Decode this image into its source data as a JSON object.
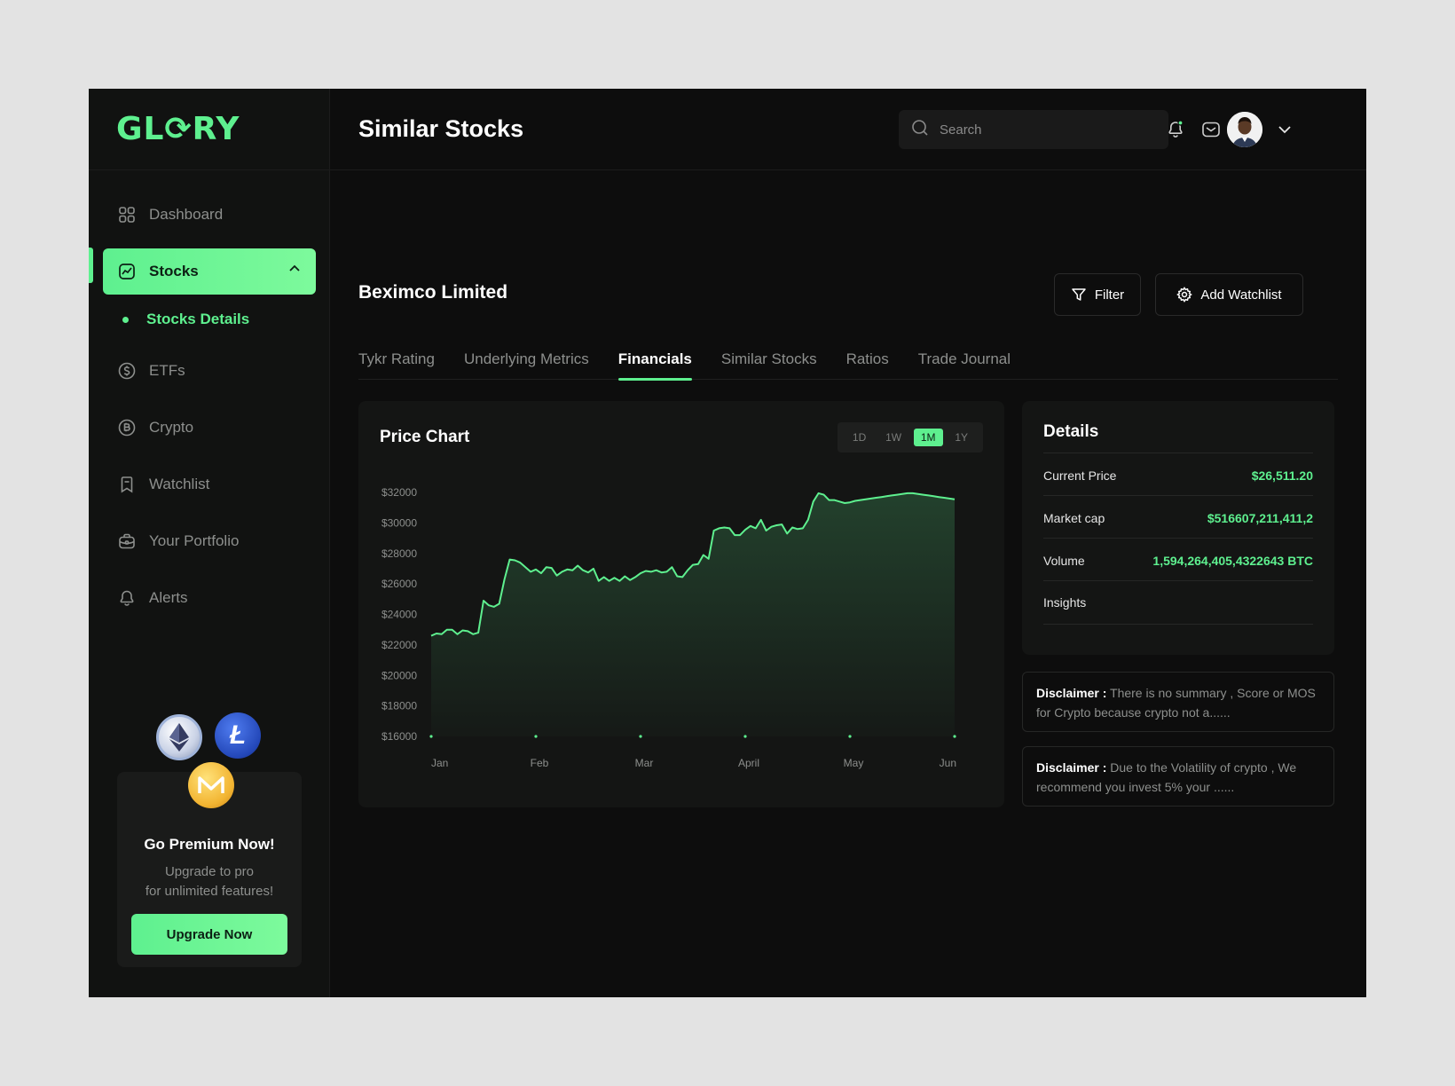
{
  "app": {
    "logo": "GL⟳RY"
  },
  "sidebar": {
    "items": [
      {
        "label": "Dashboard",
        "icon": "dashboard-icon"
      },
      {
        "label": "Stocks",
        "icon": "stocks-icon",
        "active": true
      },
      {
        "label": "Stocks Details",
        "icon": "dot-icon",
        "sub": true
      },
      {
        "label": "ETFs",
        "icon": "dollar-coin-icon"
      },
      {
        "label": "Crypto",
        "icon": "bitcoin-icon"
      },
      {
        "label": "Watchlist",
        "icon": "bookmark-icon"
      },
      {
        "label": "Your Portfolio",
        "icon": "briefcase-icon"
      },
      {
        "label": "Alerts",
        "icon": "bell-icon"
      }
    ],
    "premium": {
      "title": "Go Premium Now!",
      "line1": "Upgrade to pro",
      "line2": "for unlimited features!",
      "button": "Upgrade Now"
    }
  },
  "header": {
    "title": "Similar Stocks",
    "search_placeholder": "Search"
  },
  "main": {
    "company": "Beximco Limited",
    "filter_label": "Filter",
    "watchlist_label": "Add Watchlist",
    "tabs": [
      "Tykr Rating",
      "Underlying Metrics",
      "Financials",
      "Similar Stocks",
      "Ratios",
      "Trade Journal"
    ],
    "active_tab": "Financials"
  },
  "chart_card": {
    "title": "Price Chart",
    "ranges": [
      "1D",
      "1W",
      "1M",
      "1Y"
    ],
    "active_range": "1M"
  },
  "chart_data": {
    "type": "area",
    "title": "Price Chart",
    "xlabel": "",
    "ylabel": "",
    "x_tick_labels": [
      "Jan",
      "Feb",
      "Mar",
      "April",
      "May",
      "Jun"
    ],
    "y_tick_labels": [
      "$32000",
      "$30000",
      "$28000",
      "$26000",
      "$24000",
      "$22000",
      "$20000",
      "$18000",
      "$16000"
    ],
    "ylim": [
      16000,
      32000
    ],
    "xlim": [
      0,
      5
    ],
    "color": "#5ef08f",
    "grid": false,
    "series": [
      {
        "x": [
          0,
          0.05,
          0.1,
          0.15,
          0.2,
          0.25,
          0.3,
          0.35,
          0.4,
          0.45,
          0.5,
          0.55,
          0.6,
          0.65,
          0.7,
          0.75,
          0.8,
          0.85,
          0.9,
          0.95,
          1.0,
          1.05,
          1.1,
          1.15,
          1.2,
          1.25,
          1.3,
          1.35,
          1.4,
          1.45,
          1.5,
          1.55,
          1.6,
          1.65,
          1.7,
          1.75,
          1.8,
          1.85,
          1.9,
          1.95,
          2.0,
          2.05,
          2.1,
          2.15,
          2.2,
          2.25,
          2.3,
          2.35,
          2.4,
          2.45,
          2.5,
          2.55,
          2.6,
          2.65,
          2.7,
          2.75,
          2.8,
          2.85,
          2.9,
          2.95,
          3.0,
          3.05,
          3.1,
          3.15,
          3.2,
          3.25,
          3.3,
          3.35,
          3.4,
          3.45,
          3.5,
          3.55,
          3.6,
          3.65,
          3.7,
          3.75,
          3.8,
          3.85,
          3.9,
          3.95,
          4.0,
          4.05,
          4.1,
          4.15,
          4.2,
          4.25,
          4.3,
          4.35,
          4.4,
          4.45,
          4.5,
          4.55,
          4.6,
          4.65,
          4.7,
          4.75,
          4.8,
          4.85,
          4.9,
          4.95,
          5.0
        ],
        "y": [
          22600,
          22750,
          22700,
          23000,
          23000,
          22700,
          22950,
          22900,
          22700,
          22800,
          24900,
          24600,
          24500,
          24700,
          26300,
          27600,
          27550,
          27400,
          27100,
          26800,
          26950,
          26700,
          27100,
          27050,
          26550,
          26800,
          26950,
          26900,
          27200,
          26900,
          26750,
          27000,
          26200,
          26450,
          26200,
          26400,
          26200,
          26500,
          26250,
          26450,
          26700,
          26850,
          26800,
          26900,
          26750,
          26800,
          27100,
          26500,
          26450,
          26900,
          27250,
          27300,
          27900,
          27650,
          29500,
          29650,
          29700,
          29650,
          29200,
          29200,
          29550,
          29800,
          29650,
          30200,
          29500,
          29750,
          29850,
          29900,
          29300,
          29700,
          29600,
          29650,
          30200,
          31400,
          31950,
          31850,
          31500,
          31500,
          31400,
          31300,
          31350,
          31450,
          31500,
          31550,
          31600,
          31650,
          31700,
          31750,
          31800,
          31850,
          31900,
          31950,
          31950,
          31900,
          31850,
          31800,
          31750,
          31700,
          31650,
          31600,
          31550
        ]
      }
    ]
  },
  "details": {
    "title": "Details",
    "rows": [
      {
        "label": "Current Price",
        "value": "$26,511.20"
      },
      {
        "label": "Market cap",
        "value": "$516607,211,411,2"
      },
      {
        "label": "Volume",
        "value": "1,594,264,405,4322643 BTC"
      },
      {
        "label": "Insights",
        "value": ""
      }
    ]
  },
  "disclaimers": [
    {
      "label": "Disclaimer :",
      "text": "There is no summary , Score or MOS for Crypto because crypto  not a......"
    },
    {
      "label": "Disclaimer :",
      "text": "Due to the Volatility of crypto , We recommend you invest 5% your ......"
    }
  ]
}
